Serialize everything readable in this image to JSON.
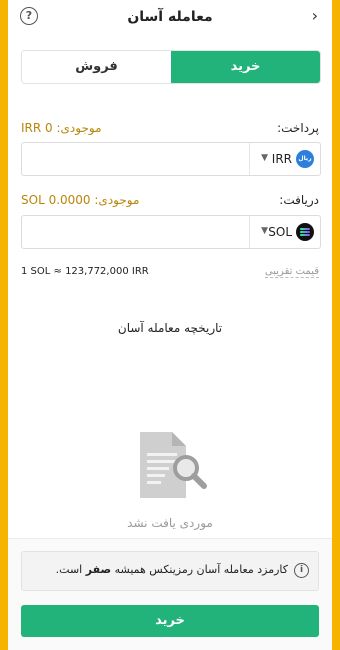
{
  "header": {
    "title": "معامله آسان",
    "help_icon": "question-circle-icon",
    "back_icon": "chevron-right-icon"
  },
  "tabs": {
    "buy_label": "خرید",
    "sell_label": "فروش",
    "active": "buy"
  },
  "pay": {
    "label": "پرداخت:",
    "balance": "موجودی: IRR 0",
    "currency": "IRR",
    "coin_text": "ریال",
    "value": ""
  },
  "receive": {
    "label": "دریافت:",
    "balance": "موجودی: SOL 0.0000",
    "currency": "SOL",
    "value": ""
  },
  "rate": {
    "approx_label": "قیمت تقریبی",
    "value": "1 SOL ≈ 123,772,000 IRR"
  },
  "history": {
    "title": "تاریخچه معامله آسان",
    "empty_text": "موردی یافت نشد",
    "empty_icon": "document-search-icon"
  },
  "notice": {
    "pre": "کارمزد معامله آسان رمزینکس همیشه",
    "bold": "صفر",
    "post": "است.",
    "icon": "info-icon"
  },
  "action": {
    "button_label": "خرید"
  },
  "colors": {
    "accent": "#22b37b",
    "frame": "#f6b300",
    "balance": "#b8860b"
  }
}
